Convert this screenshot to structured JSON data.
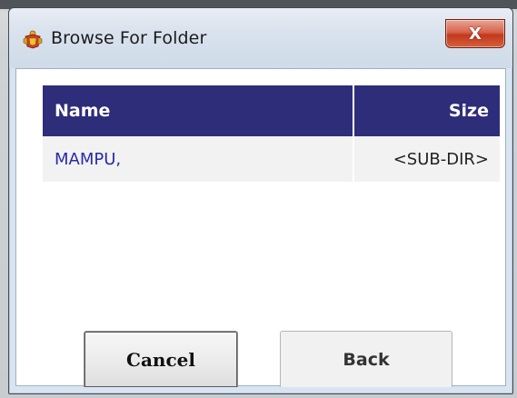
{
  "window": {
    "title": "Browse For Folder",
    "close_label": "X"
  },
  "table": {
    "columns": [
      {
        "label": "Name"
      },
      {
        "label": "Size"
      }
    ],
    "rows": [
      {
        "name": "MAMPU,",
        "size": "<SUB-DIR>"
      }
    ]
  },
  "buttons": {
    "cancel_label": "Cancel",
    "back_label": "Back"
  },
  "colors": {
    "header_bg": "#2e2d7a",
    "link_text": "#2a2aa8",
    "close_button": "#c2391d"
  },
  "icons": {
    "app": "malaysia-crest-icon",
    "close": "close-icon"
  }
}
